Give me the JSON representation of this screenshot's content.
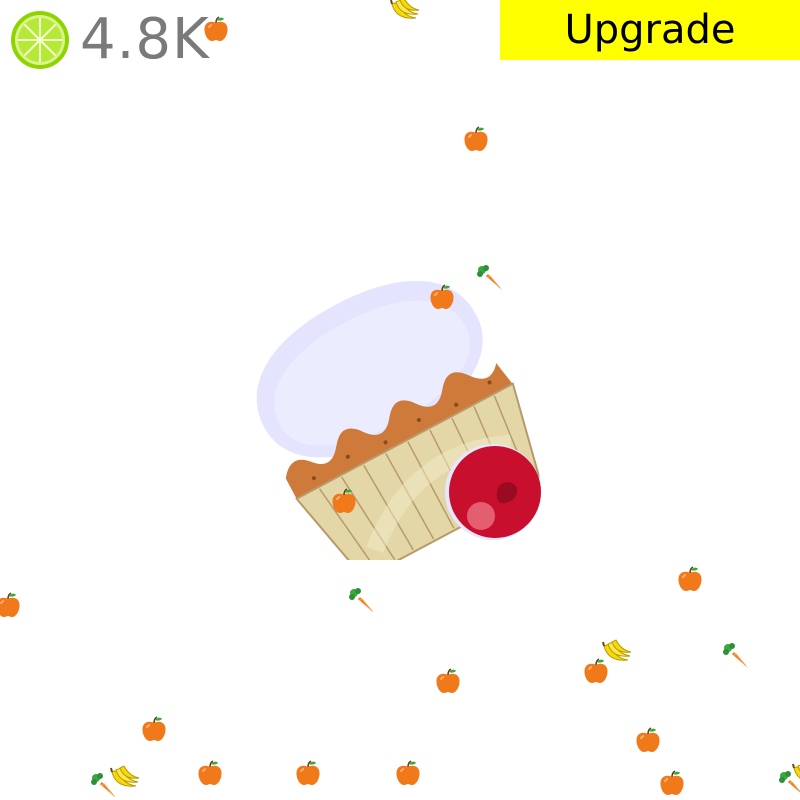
{
  "hud": {
    "score": "4.8K",
    "score_icon": "lime-slice-icon",
    "upgrade_label": "Upgrade"
  },
  "colors": {
    "upgrade_bg": "#ffff00",
    "score_text": "#7a7a7a",
    "lime": "#8fd400",
    "frosting": "#e4e4ff",
    "cake": "#cd7a3a",
    "wrapper": "#e3d7a8",
    "cherry": "#c8102e"
  },
  "clicker": {
    "name": "cupcake"
  },
  "falling_items": [
    {
      "kind": "banana"
    },
    {
      "kind": "apple"
    },
    {
      "kind": "apple"
    },
    {
      "kind": "carrot"
    },
    {
      "kind": "apple"
    },
    {
      "kind": "apple"
    },
    {
      "kind": "apple"
    },
    {
      "kind": "carrot"
    },
    {
      "kind": "apple"
    },
    {
      "kind": "banana"
    },
    {
      "kind": "apple"
    },
    {
      "kind": "carrot"
    },
    {
      "kind": "apple"
    },
    {
      "kind": "apple"
    },
    {
      "kind": "apple"
    },
    {
      "kind": "apple"
    },
    {
      "kind": "carrot"
    },
    {
      "kind": "banana"
    },
    {
      "kind": "apple"
    },
    {
      "kind": "apple"
    },
    {
      "kind": "apple"
    },
    {
      "kind": "carrot"
    },
    {
      "kind": "banana"
    }
  ]
}
